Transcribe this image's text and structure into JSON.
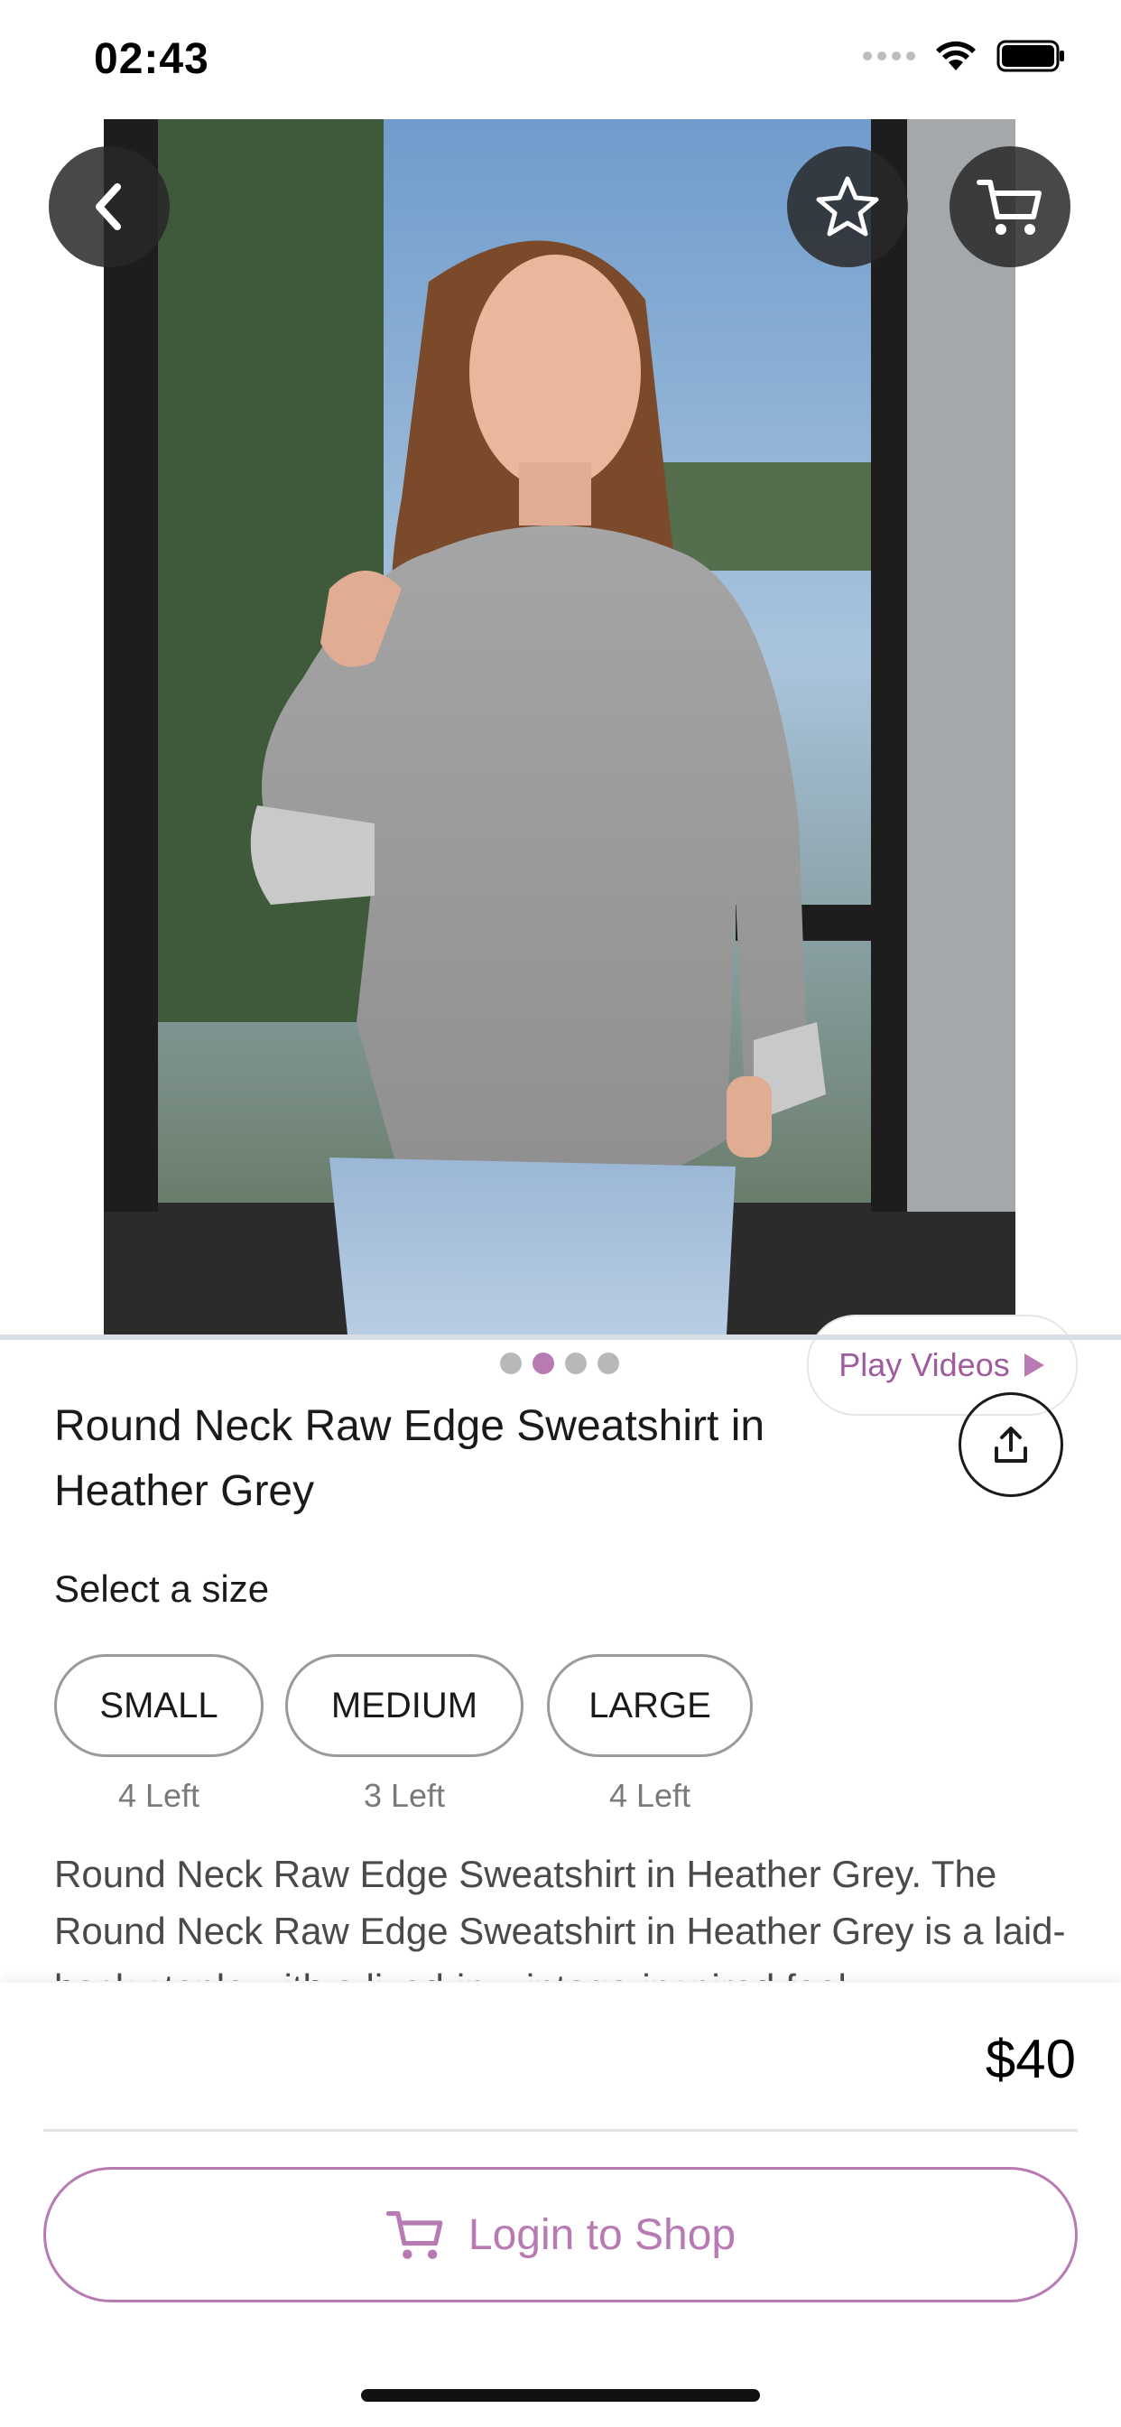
{
  "status_bar": {
    "time": "02:43"
  },
  "product": {
    "title": "Round Neck Raw Edge Sweatshirt in Heather Grey",
    "play_videos_label": "Play Videos",
    "select_size_label": "Select a size",
    "sizes": [
      {
        "label": "SMALL",
        "stock": "4 Left"
      },
      {
        "label": "MEDIUM",
        "stock": "3 Left"
      },
      {
        "label": "LARGE",
        "stock": "4 Left"
      }
    ],
    "description": "Round Neck Raw Edge Sweatshirt in Heather Grey. The Round Neck Raw Edge Sweatshirt in Heather Grey is a laid-back staple with a lived-in, vintage-inspired feel.",
    "price": "$40",
    "image_pager": {
      "count": 4,
      "active_index": 1
    }
  },
  "actions": {
    "login_label": "Login to Shop"
  },
  "icons": {
    "back": "chevron-left-icon",
    "favorite": "star-icon",
    "cart": "cart-icon",
    "share": "share-icon",
    "play": "play-icon"
  },
  "colors": {
    "accent": "#b87ab3",
    "accent_text": "#a05a9e",
    "overlay_button": "#282828"
  }
}
